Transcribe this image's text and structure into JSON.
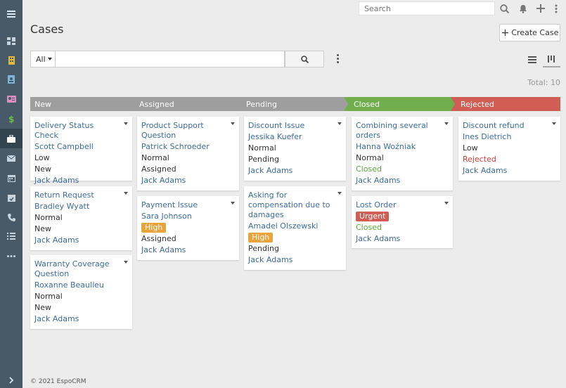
{
  "sidebar": {
    "items": [
      {
        "icon": "menu-icon"
      },
      {
        "icon": "dashboard-icon"
      },
      {
        "icon": "building-icon"
      },
      {
        "icon": "contact-book-icon"
      },
      {
        "icon": "id-card-icon"
      },
      {
        "icon": "dollar-icon"
      },
      {
        "icon": "briefcase-icon"
      },
      {
        "icon": "envelope-icon"
      },
      {
        "icon": "calendar-icon"
      },
      {
        "icon": "calendar-check-icon"
      },
      {
        "icon": "phone-icon"
      },
      {
        "icon": "tasks-icon"
      },
      {
        "icon": "more-icon"
      },
      {
        "icon": "chevron-right-icon"
      }
    ],
    "colors": {
      "bg": "#485a68",
      "active": "#34444f"
    }
  },
  "topbar": {
    "search_placeholder": "Search",
    "icons": [
      "search-icon",
      "bell-icon",
      "plus-icon",
      "kebab-icon"
    ]
  },
  "header": {
    "title": "Cases",
    "create_label": "Create Case"
  },
  "filter": {
    "scope": "All",
    "query": ""
  },
  "total": "Total: 10",
  "columns": [
    {
      "label": "New",
      "cards": [
        {
          "name": "Delivery Status Check",
          "contact": "Scott Campbell",
          "priority": "Low",
          "status": "New",
          "assigned": "Jack Adams"
        },
        {
          "name": "Return Request",
          "contact": "Bradley Wyatt",
          "priority": "Normal",
          "status": "New",
          "assigned": "Jack Adams"
        },
        {
          "name": "Warranty Coverage Question",
          "contact": "Roxanne Beaulieu",
          "priority": "Normal",
          "status": "New",
          "assigned": "Jack Adams"
        }
      ]
    },
    {
      "label": "Assigned",
      "cards": [
        {
          "name": "Product Support Question",
          "contact": "Patrick Schroeder",
          "priority": "Normal",
          "status": "Assigned",
          "assigned": "Jack Adams"
        },
        {
          "name": "Payment Issue",
          "contact": "Sara Johnson",
          "priority": "High",
          "status": "Assigned",
          "assigned": "Jack Adams"
        }
      ]
    },
    {
      "label": "Pending",
      "cards": [
        {
          "name": "Discount Issue",
          "contact": "Jessika Kuefer",
          "priority": "Normal",
          "status": "Pending",
          "assigned": "Jack Adams"
        },
        {
          "name": "Asking for compensation due to damages",
          "contact": "Amadei Olszewski",
          "priority": "High",
          "status": "Pending",
          "assigned": "Jack Adams"
        }
      ]
    },
    {
      "label": "Closed",
      "cards": [
        {
          "name": "Combining several orders",
          "contact": "Hanna Woźniak",
          "priority": "Normal",
          "status": "Closed",
          "assigned": "Jack Adams"
        },
        {
          "name": "Lost Order",
          "priority": "Urgent",
          "status": "Closed",
          "assigned": "Jack Adams"
        }
      ]
    },
    {
      "label": "Rejected",
      "cards": [
        {
          "name": "Discount refund",
          "contact": "Ines Dietrich",
          "priority": "Low",
          "status": "Rejected",
          "assigned": "Jack Adams"
        }
      ]
    }
  ],
  "colors": {
    "closed": "#70ae4e",
    "rejected": "#d15d55",
    "stage": "#9e9e9e",
    "link": "#3d6c9f",
    "high": "#e8a33a",
    "urgent": "#d15d55"
  },
  "footer": "© 2021 EspoCRM"
}
